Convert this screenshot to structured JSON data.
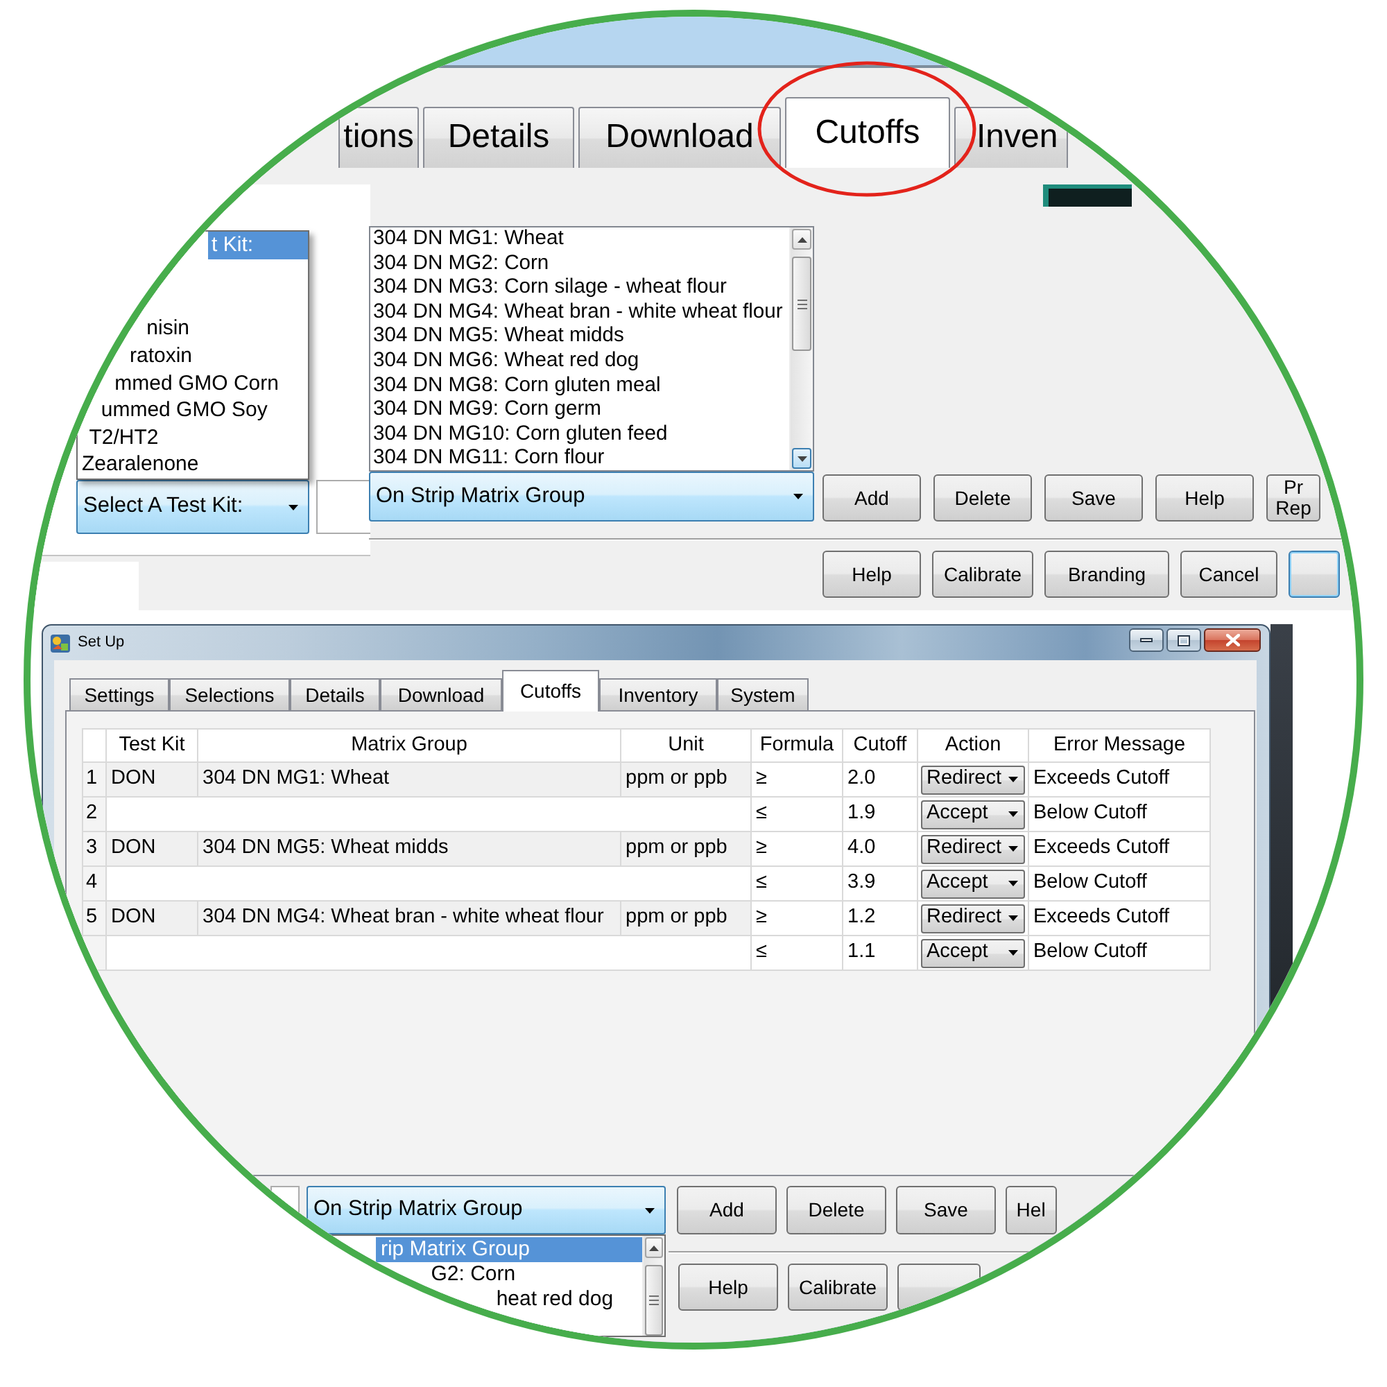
{
  "zoomed_view": {
    "tabs": [
      {
        "label": "tions",
        "selected": false
      },
      {
        "label": "Details",
        "selected": false
      },
      {
        "label": "Download",
        "selected": false
      },
      {
        "label": "Cutoffs",
        "selected": true
      },
      {
        "label": "Inven",
        "selected": false
      }
    ],
    "test_kit_list": [
      {
        "label": "t Kit:",
        "selected": true
      },
      {
        "label": "nisin",
        "selected": false
      },
      {
        "label": "ratoxin",
        "selected": false
      },
      {
        "label": "mmed GMO Corn",
        "selected": false
      },
      {
        "label": "ummed GMO Soy",
        "selected": false
      },
      {
        "label": "T2/HT2",
        "selected": false
      },
      {
        "label": "Zearalenone",
        "selected": false
      }
    ],
    "test_kit_select": "Select A Test Kit:",
    "matrix_group_list": [
      "304 DN MG1: Wheat",
      "304 DN MG2: Corn",
      "304 DN MG3: Corn silage - wheat flour",
      "304 DN MG4: Wheat bran - white wheat flour",
      "304 DN MG5: Wheat midds",
      "304 DN MG6: Wheat red dog",
      "304 DN MG8: Corn gluten meal",
      "304 DN MG9: Corn germ",
      "304 DN MG10: Corn gluten feed",
      "304 DN MG11: Corn flour"
    ],
    "matrix_group_select": "On Strip Matrix Group",
    "buttons": [
      {
        "kind": "normal",
        "label": "Add"
      },
      {
        "kind": "normal",
        "label": "Delete"
      },
      {
        "kind": "normal",
        "label": "Save"
      },
      {
        "kind": "normal",
        "label": "Help"
      },
      {
        "kind": "normal",
        "label": "Pr Rep"
      }
    ],
    "dialog_buttons": [
      {
        "kind": "normal",
        "label": "Help"
      },
      {
        "kind": "normal",
        "label": "Calibrate"
      },
      {
        "kind": "normal",
        "label": "Branding"
      },
      {
        "kind": "normal",
        "label": "Cancel"
      },
      {
        "kind": "default"
      }
    ]
  },
  "window": {
    "title": "Set Up",
    "tabs": [
      {
        "label": "Settings",
        "selected": false
      },
      {
        "label": "Selections",
        "selected": false
      },
      {
        "label": "Details",
        "selected": false
      },
      {
        "label": "Download",
        "selected": false
      },
      {
        "label": "Cutoffs",
        "selected": true
      },
      {
        "label": "Inventory",
        "selected": false
      },
      {
        "label": "System",
        "selected": false
      }
    ],
    "table": {
      "columns": [
        "Test Kit",
        "Matrix Group",
        "Unit",
        "Formula",
        "Cutoff",
        "Action",
        "Error Message"
      ],
      "rows": [
        {
          "number": "1",
          "test_kit": "DON",
          "matrix_group": "304 DN MG1: Wheat",
          "unit": "ppm or ppb",
          "formula": "≥",
          "cutoff": "2.0",
          "action": "Redirect",
          "error_message": "Exceeds Cutoff"
        },
        {
          "number": "2",
          "formula": "≤",
          "cutoff": "1.9",
          "action": "Accept",
          "error_message": "Below Cutoff"
        },
        {
          "number": "3",
          "test_kit": "DON",
          "matrix_group": "304 DN MG5: Wheat midds",
          "unit": "ppm or ppb",
          "formula": "≥",
          "cutoff": "4.0",
          "action": "Redirect",
          "error_message": "Exceeds Cutoff"
        },
        {
          "number": "4",
          "formula": "≤",
          "cutoff": "3.9",
          "action": "Accept",
          "error_message": "Below Cutoff"
        },
        {
          "number": "5",
          "test_kit": "DON",
          "matrix_group": "304 DN MG4: Wheat bran - white wheat flour",
          "unit": "ppm or ppb",
          "formula": "≥",
          "cutoff": "1.2",
          "action": "Redirect",
          "error_message": "Exceeds Cutoff"
        },
        {
          "formula": "≤",
          "cutoff": "1.1",
          "action": "Accept",
          "error_message": "Below Cutoff"
        }
      ]
    },
    "matrix_group_select": "On Strip Matrix Group",
    "matrix_group_options": [
      {
        "label": "rip Matrix Group",
        "selected": true
      },
      {
        "label": "G2: Corn",
        "selected": false
      },
      {
        "label": "heat red dog",
        "selected": false
      }
    ],
    "buttons": [
      {
        "kind": "normal",
        "label": "Add"
      },
      {
        "kind": "normal",
        "label": "Delete"
      },
      {
        "kind": "normal",
        "label": "Save"
      },
      {
        "kind": "normal",
        "label": "Hel"
      }
    ],
    "dialog_buttons": [
      {
        "kind": "normal",
        "label": "Help"
      },
      {
        "kind": "normal",
        "label": "Calibrate"
      },
      {
        "kind": "normal"
      }
    ]
  }
}
